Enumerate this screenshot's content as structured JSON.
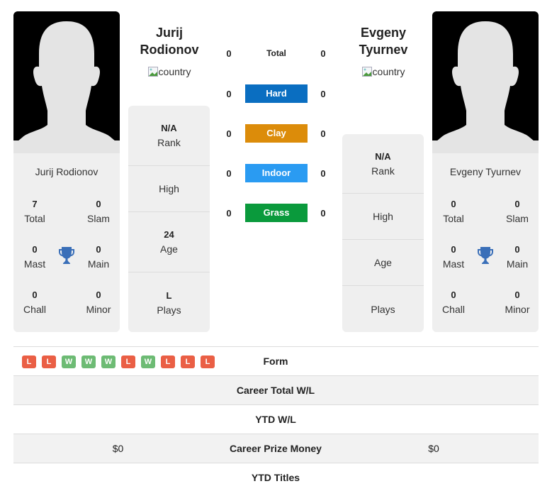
{
  "player1": {
    "name_line1": "Jurij",
    "name_line2": "Rodionov",
    "full_name": "Jurij Rodionov",
    "flag_alt": "country",
    "titles": {
      "total": {
        "value": "7",
        "label": "Total"
      },
      "slam": {
        "value": "0",
        "label": "Slam"
      },
      "mast": {
        "value": "0",
        "label": "Mast"
      },
      "main": {
        "value": "0",
        "label": "Main"
      },
      "chall": {
        "value": "0",
        "label": "Chall"
      },
      "minor": {
        "value": "0",
        "label": "Minor"
      }
    },
    "info": {
      "rank": {
        "value": "N/A",
        "label": "Rank"
      },
      "high": {
        "value": "",
        "label": "High"
      },
      "age": {
        "value": "24",
        "label": "Age"
      },
      "plays": {
        "value": "L",
        "label": "Plays"
      }
    }
  },
  "player2": {
    "name_line1": "Evgeny",
    "name_line2": "Tyurnev",
    "full_name": "Evgeny Tyurnev",
    "flag_alt": "country",
    "titles": {
      "total": {
        "value": "0",
        "label": "Total"
      },
      "slam": {
        "value": "0",
        "label": "Slam"
      },
      "mast": {
        "value": "0",
        "label": "Mast"
      },
      "main": {
        "value": "0",
        "label": "Main"
      },
      "chall": {
        "value": "0",
        "label": "Chall"
      },
      "minor": {
        "value": "0",
        "label": "Minor"
      }
    },
    "info": {
      "rank": {
        "value": "N/A",
        "label": "Rank"
      },
      "high": {
        "value": "",
        "label": "High"
      },
      "age": {
        "value": "",
        "label": "Age"
      },
      "plays": {
        "value": "",
        "label": "Plays"
      }
    }
  },
  "h2h": {
    "rows": [
      {
        "label": "Total",
        "left": "0",
        "right": "0",
        "color": ""
      },
      {
        "label": "Hard",
        "left": "0",
        "right": "0",
        "color": "#0a6ec1"
      },
      {
        "label": "Clay",
        "left": "0",
        "right": "0",
        "color": "#dc8c0a"
      },
      {
        "label": "Indoor",
        "left": "0",
        "right": "0",
        "color": "#2a9bf2"
      },
      {
        "label": "Grass",
        "left": "0",
        "right": "0",
        "color": "#0a9a3c"
      }
    ]
  },
  "form": {
    "results": [
      "L",
      "L",
      "W",
      "W",
      "W",
      "L",
      "W",
      "L",
      "L",
      "L"
    ],
    "colors": {
      "W": "#6dbb74",
      "L": "#ea5f45"
    }
  },
  "comparison": {
    "rows": [
      {
        "label": "Form",
        "left": "",
        "right": ""
      },
      {
        "label": "Career Total W/L",
        "left": "",
        "right": ""
      },
      {
        "label": "YTD W/L",
        "left": "",
        "right": ""
      },
      {
        "label": "Career Prize Money",
        "left": "$0",
        "right": "$0"
      },
      {
        "label": "YTD Titles",
        "left": "",
        "right": ""
      }
    ]
  },
  "icons": {
    "trophy": "trophy-icon",
    "avatar": "avatar-silhouette",
    "flag": "broken-image-icon"
  },
  "colors": {
    "trophy": "#3a6fb8",
    "card_bg": "#efefef"
  }
}
